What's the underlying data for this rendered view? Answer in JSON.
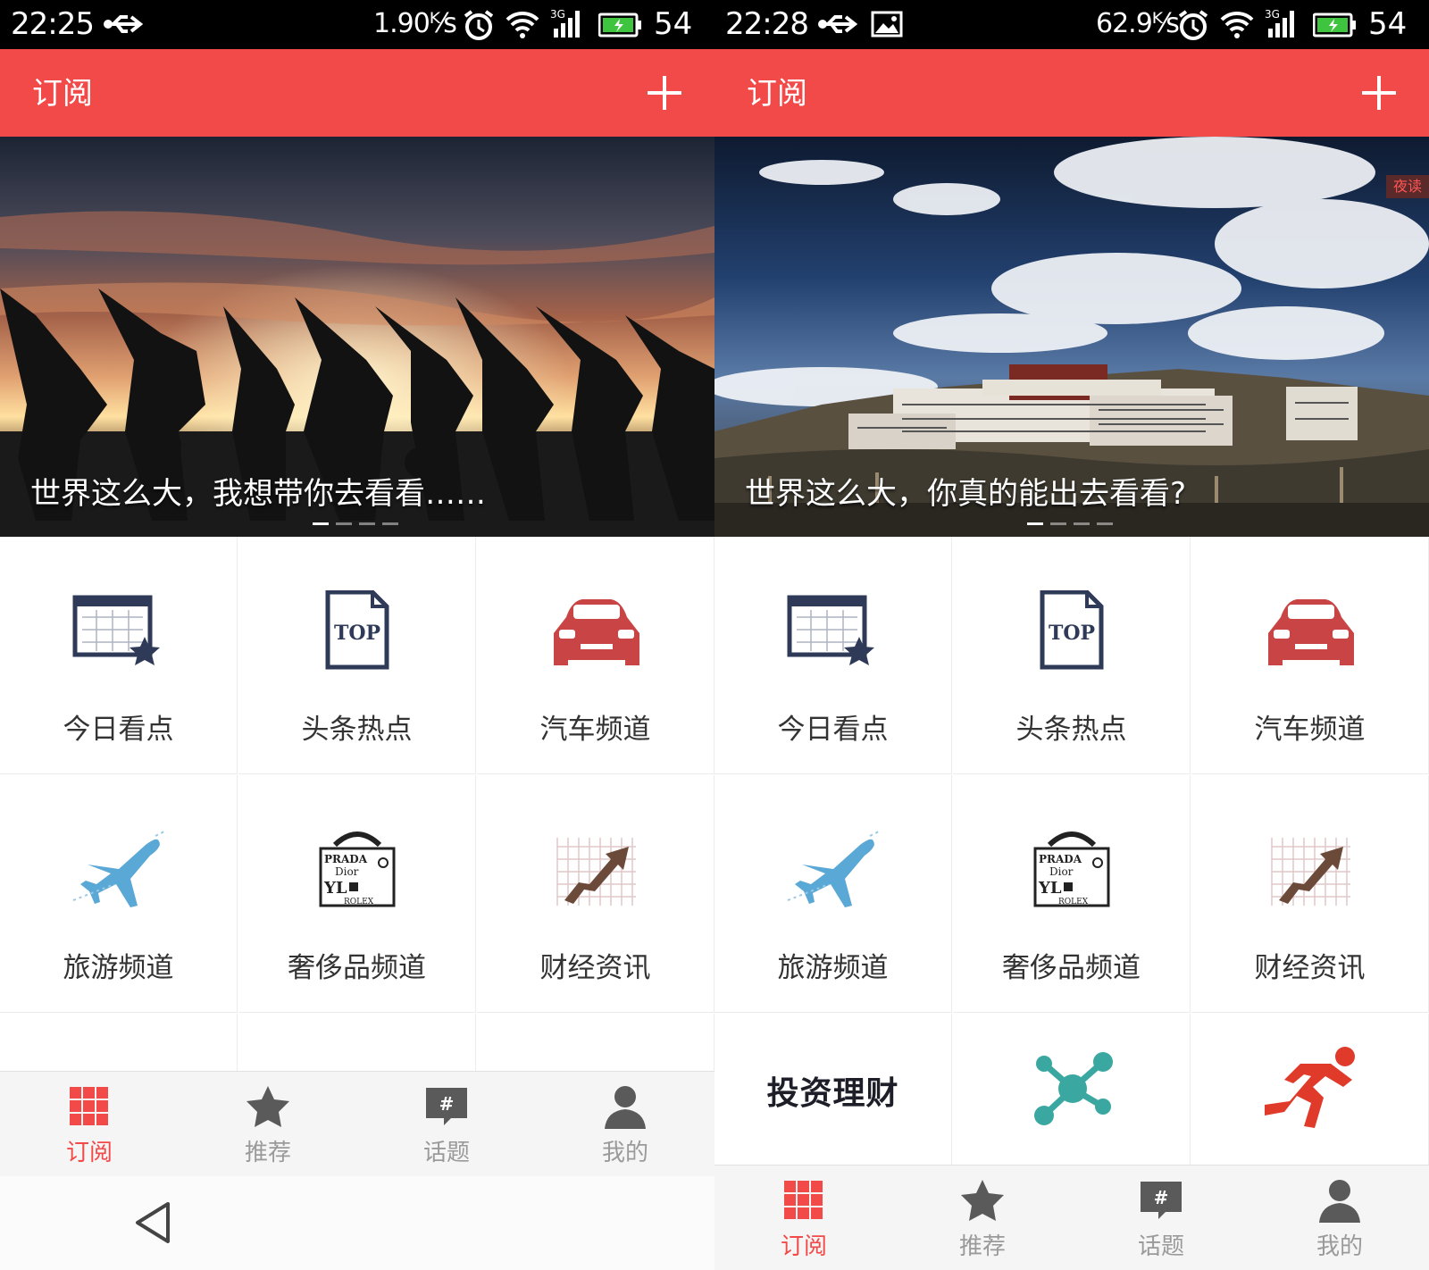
{
  "screens": [
    {
      "status": {
        "time": "22:25",
        "speed": "1.90ᴷ⁄s",
        "battery": "54"
      },
      "header": {
        "title": "订阅"
      },
      "banner": {
        "caption": "世界这么大，我想带你去看看……",
        "dots_total": 4,
        "dots_active": 1
      },
      "tiles": [
        "今日看点",
        "头条热点",
        "汽车频道",
        "旅游频道",
        "奢侈品频道",
        "财经资讯"
      ],
      "nav": [
        "订阅",
        "推荐",
        "话题",
        "我的"
      ]
    },
    {
      "status": {
        "time": "22:28",
        "speed": "62.9ᴷ⁄s",
        "battery": "54"
      },
      "header": {
        "title": "订阅"
      },
      "banner": {
        "caption": "世界这么大，你真的能出去看看?",
        "night_badge": "夜读",
        "dots_total": 4,
        "dots_active": 1
      },
      "tiles": [
        "今日看点",
        "头条热点",
        "汽车频道",
        "旅游频道",
        "奢侈品频道",
        "财经资讯"
      ],
      "extra_tiles": {
        "invest_text": "投资理财"
      },
      "nav": [
        "订阅",
        "推荐",
        "话题",
        "我的"
      ]
    }
  ],
  "colors": {
    "accent": "#f24949",
    "inactive": "#9a9a9a",
    "icon_navy": "#2e3a57",
    "car_red": "#c94545"
  },
  "icons": [
    "usb-icon",
    "gallery-icon",
    "alarm-icon",
    "wifi-icon",
    "signal-3g-icon",
    "battery-icon",
    "plus-icon",
    "calendar-star-icon",
    "top-doc-icon",
    "car-icon",
    "airplane-icon",
    "luxury-brands-icon",
    "finance-arrow-icon",
    "network-icon",
    "runner-icon",
    "grid-icon",
    "star-icon",
    "hashtag-bubble-icon",
    "person-icon",
    "back-icon"
  ]
}
